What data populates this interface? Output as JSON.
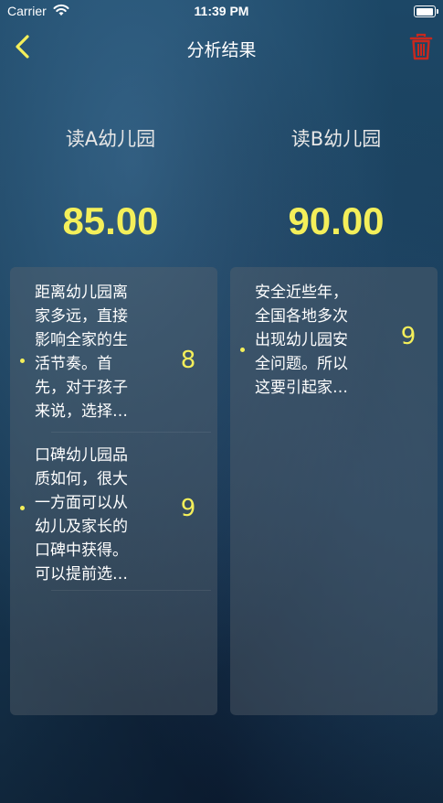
{
  "status_bar": {
    "carrier": "Carrier",
    "time": "11:39 PM",
    "battery_level": 1.0
  },
  "nav": {
    "title": "分析结果",
    "back_icon": "chevron-left-icon",
    "trash_icon": "trash-icon",
    "accent_color": "#f4ef5a",
    "trash_color": "#c8281e"
  },
  "columns": [
    {
      "title": "读A幼儿园",
      "score": "85.00",
      "reasons": [
        {
          "text": "距离幼儿园离\n家多远，直接\n影响全家的生\n活节奏。首\n先，对于孩子\n来说，选择…",
          "score": "8"
        },
        {
          "text": "口碑幼儿园品\n质如何，很大\n一方面可以从\n幼儿及家长的\n口碑中获得。\n可以提前选…",
          "score": "9"
        }
      ]
    },
    {
      "title": "读B幼儿园",
      "score": "90.00",
      "reasons": [
        {
          "text": "安全近些年，\n全国各地多次\n出现幼儿园安\n全问题。所以\n这要引起家…",
          "score": "9"
        }
      ]
    }
  ]
}
